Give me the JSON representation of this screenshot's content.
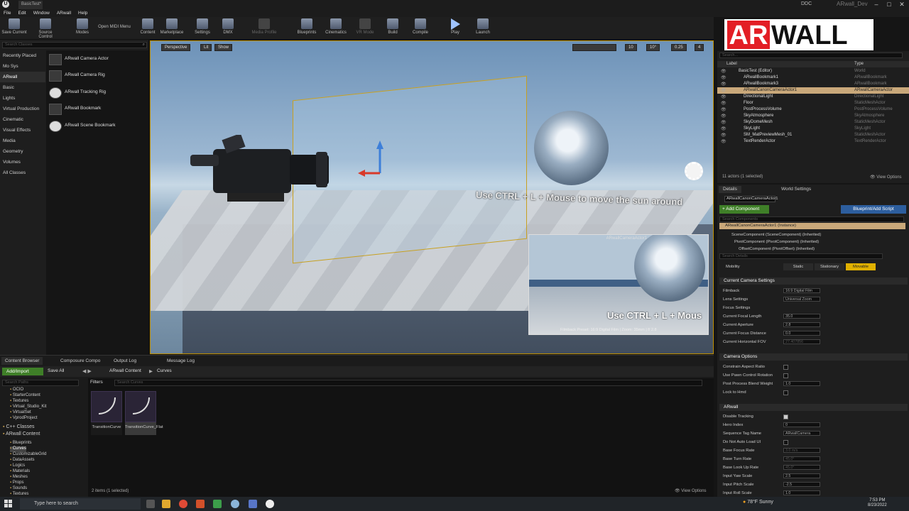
{
  "title_bar": {
    "tab": "BasicTest*",
    "ddc": "DDC",
    "project": "ARwall_Dev"
  },
  "menu": [
    "File",
    "Edit",
    "Window",
    "ARwall",
    "Help"
  ],
  "toolbar": {
    "save": "Save Current",
    "source": "Source Control",
    "modes": "Modes",
    "midi": "Open MIDI Menu",
    "content": "Content",
    "marketplace": "Marketplace",
    "settings": "Settings",
    "dmx": "DMX",
    "media_profile": "Media Profile",
    "blueprints": "Blueprints",
    "cinematics": "Cinematics",
    "vr_mode": "VR Mode",
    "build": "Build",
    "compile": "Compile",
    "play": "Play",
    "launch": "Launch"
  },
  "logo": {
    "red": "AR",
    "black": "WALL"
  },
  "place_actors": {
    "search_placeholder": "Search Classes",
    "categories": [
      "Recently Placed",
      "Mo Sys",
      "ARwall",
      "Basic",
      "Lights",
      "Virtual Production",
      "Cinematic",
      "Visual Effects",
      "Media",
      "Geometry",
      "Volumes",
      "All Classes"
    ],
    "selected_category": "ARwall",
    "items": [
      "ARwall Camera Actor",
      "ARwall Camera Rig",
      "ARwall Tracking Rig",
      "ARwall Bookmark",
      "ARwall Scene Bookmark"
    ]
  },
  "viewport": {
    "perspective": "Perspective",
    "lit": "Lit",
    "show": "Show",
    "grid_snap": "10",
    "rot_snap": "10°",
    "scale_snap": "0.25",
    "cam_speed": "4",
    "hint": "Use CTRL + L + Mouse to move the sun around",
    "pip": {
      "name": "ARwallCameraActor1",
      "text": "Use CTRL + L + Mous",
      "footer": "Filmback Preset: 16:9 Digital Film | Zoom: 35mm | f/ 2.8"
    }
  },
  "outliner": {
    "search_placeholder": "Search...",
    "col_label": "Label",
    "col_type": "Type",
    "rows": [
      {
        "label": "BasicTest (Editor)",
        "type": "World"
      },
      {
        "label": "ARwallBookmark1",
        "type": "ARwallBookmark"
      },
      {
        "label": "ARwallBookmark3",
        "type": "ARwallBookmark"
      },
      {
        "label": "ARwallCanonCameraActor1",
        "type": "ARwallCameraActor"
      },
      {
        "label": "DirectionalLight",
        "type": "DirectionalLight"
      },
      {
        "label": "Floor",
        "type": "StaticMeshActor"
      },
      {
        "label": "PostProcessVolume",
        "type": "PostProcessVolume"
      },
      {
        "label": "SkyAtmosphere",
        "type": "SkyAtmosphere"
      },
      {
        "label": "SkyDomeMesh",
        "type": "StaticMeshActor"
      },
      {
        "label": "SkyLight",
        "type": "SkyLight"
      },
      {
        "label": "SM_MatPreviewMesh_01",
        "type": "StaticMeshActor"
      },
      {
        "label": "TextRenderActor",
        "type": "TextRenderActor"
      }
    ],
    "selected_index": 3,
    "count": "11 actors (1 selected)",
    "view_options": "View Options"
  },
  "details": {
    "tab_details": "Details",
    "tab_world": "World Settings",
    "name": "ARwallCanonCameraActor1",
    "add_component": "+ Add Component",
    "blueprint": "Blueprint/Add Script",
    "search_components": "Search Components",
    "instance": "ARwallCanonCameraActor1 (Instance)",
    "components": [
      "SceneComponent (SceneComponent) (Inherited)",
      "PivotComponent (PivotComponent) (Inherited)",
      "OffsetComponent (PivotOffset) (Inherited)"
    ],
    "search_details": "Search Details",
    "mobility": {
      "label": "Mobility",
      "static": "Static",
      "stationary": "Stationary",
      "movable": "Movable"
    },
    "camera_settings": {
      "header": "Current Camera Settings",
      "props": [
        {
          "label": "Filmback",
          "value": "16:9 Digital Film"
        },
        {
          "label": "Lens Settings",
          "value": "Universal Zoom"
        },
        {
          "label": "Focus Settings",
          "value": ""
        },
        {
          "label": "Current Focal Length",
          "value": "35.0"
        },
        {
          "label": "Current Aperture",
          "value": "2.8"
        },
        {
          "label": "Current Focus Distance",
          "value": "0.0"
        },
        {
          "label": "Current Horizontal FOV",
          "value": "27.407856"
        }
      ]
    },
    "camera_options": {
      "header": "Camera Options",
      "props": [
        {
          "label": "Constrain Aspect Ratio",
          "value": ""
        },
        {
          "label": "Use Pawn Control Rotation",
          "value": ""
        },
        {
          "label": "Post Process Blend Weight",
          "value": "1.0"
        },
        {
          "label": "Lock to Hmd",
          "value": ""
        }
      ]
    },
    "arwall": {
      "header": "ARwall",
      "props": [
        {
          "label": "Disable Tracking",
          "value": ""
        },
        {
          "label": "Hero Index",
          "value": "0"
        },
        {
          "label": "Sequence Tag Name",
          "value": "ARwallCamera"
        },
        {
          "label": "Do Not Auto Load UI",
          "value": ""
        },
        {
          "label": "Base Focus Rate",
          "value": "3.0 m/s"
        },
        {
          "label": "Base Turn Rate",
          "value": "45.0°"
        },
        {
          "label": "Base Look Up Rate",
          "value": "45.0°"
        },
        {
          "label": "Input Yaw Scale",
          "value": "2.5"
        },
        {
          "label": "Input Pitch Scale",
          "value": "-2.5"
        },
        {
          "label": "Input Roll Scale",
          "value": "1.0"
        }
      ]
    }
  },
  "bottom": {
    "tabs": [
      "Content Browser",
      "Composure Compo",
      "Output Log",
      "Message Log"
    ],
    "add_import": "Add/Import",
    "save_all": "Save All",
    "path": [
      "ARwall Content",
      "Curves"
    ],
    "search_paths": "Search Paths",
    "tree": [
      "OCIO",
      "StarterContent",
      "Textures",
      "Virtual_Studio_Kit",
      "VirtualSet",
      "VprodProject",
      "C++ Classes",
      "ARwall Content",
      "Blueprints",
      "Curves",
      "CustomizableGrid",
      "DataAssets",
      "Logics",
      "Materials",
      "Meshes",
      "Props",
      "Sounds",
      "Textures"
    ],
    "filters": "Filters",
    "search_curves": "Search Curves",
    "assets": [
      {
        "name": "TransitionCurve"
      },
      {
        "name": "TransitionCurve_Flat"
      }
    ],
    "count": "2 items (1 selected)",
    "view_options": "View Options"
  },
  "taskbar": {
    "search": "Type here to search",
    "weather": "78°F Sunny",
    "time": "7:53 PM",
    "date": "8/23/2022"
  }
}
